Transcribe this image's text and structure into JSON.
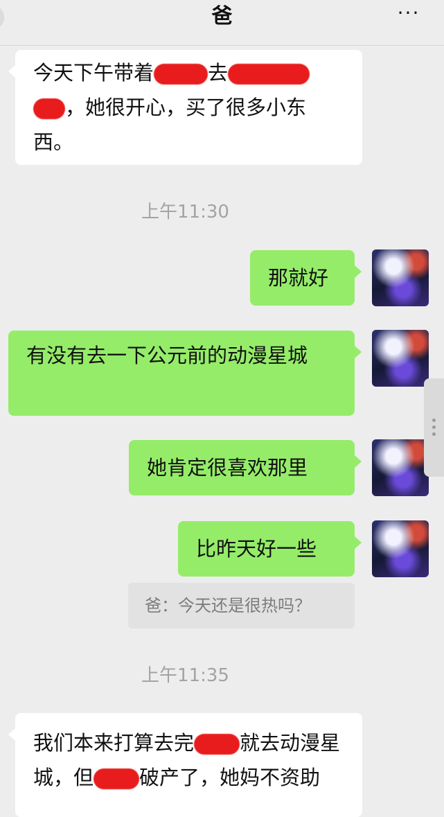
{
  "header": {
    "title": "爸",
    "more_icon": "···"
  },
  "messages": [
    {
      "direction": "in",
      "parts": [
        "今天下午带着",
        "[redacted]",
        "去",
        "[redacted]",
        "[redacted]",
        "，她很开心，买了很多小东西。"
      ]
    },
    {
      "type": "time",
      "text": "上午11:30"
    },
    {
      "direction": "out",
      "text": "那就好"
    },
    {
      "direction": "out",
      "text": "有没有去一下公元前的动漫星城"
    },
    {
      "direction": "out",
      "text": "她肯定很喜欢那里"
    },
    {
      "direction": "out",
      "text": "比昨天好一些",
      "quote": "爸：今天还是很热吗？"
    },
    {
      "type": "time",
      "text": "上午11:35"
    },
    {
      "direction": "in",
      "parts": [
        "我们本来打算去完",
        "[redacted]",
        "就去动漫星城，但",
        "[redacted]",
        "破产了，她妈不资助"
      ]
    }
  ],
  "colors": {
    "background": "#ededed",
    "incoming_bubble": "#ffffff",
    "outgoing_bubble": "#95ec69",
    "redaction": "#e81c1c",
    "timestamp_text": "#a3a3a3"
  }
}
